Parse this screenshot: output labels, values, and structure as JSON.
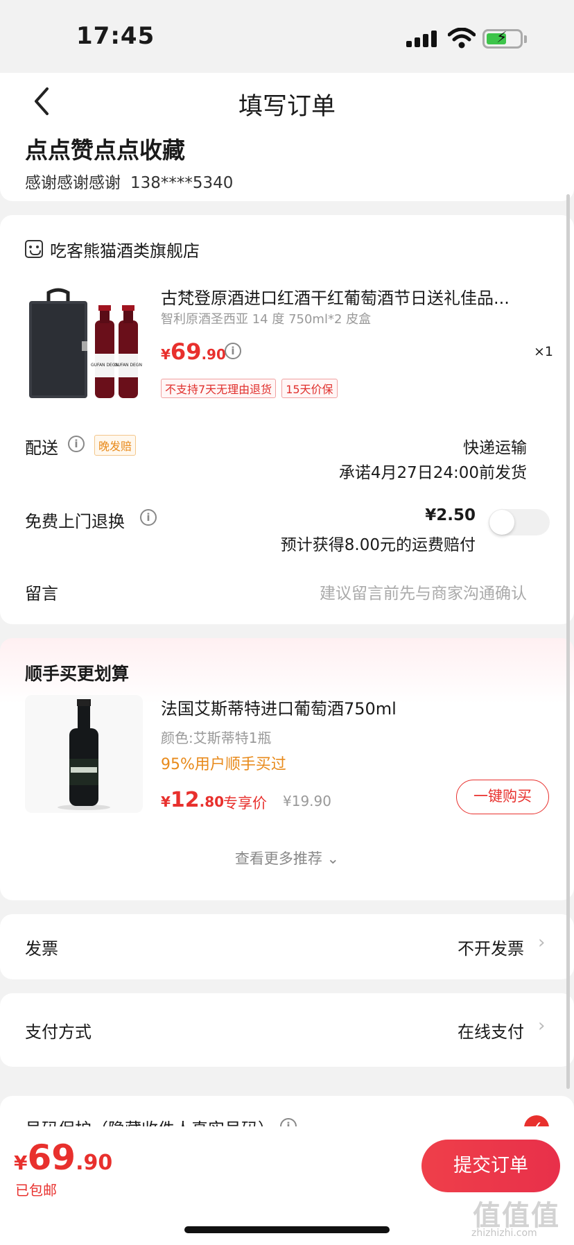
{
  "status_bar": {
    "time": "17:45"
  },
  "nav": {
    "title": "填写订单"
  },
  "address": {
    "name": "点点赞点点收藏",
    "recipient": "感谢感谢感谢",
    "phone": "138****5340"
  },
  "shop": {
    "name": "吃客熊猫酒类旗舰店"
  },
  "product": {
    "title": "古梵登原酒进口红酒干红葡萄酒节日送礼佳品...",
    "spec": "智利原酒圣西亚 14 度 750ml*2 皮盒",
    "price_symbol": "¥",
    "price_int": "69",
    "price_dec": ".90",
    "qty": "×1",
    "tags": [
      "不支持7天无理由退货",
      "15天价保"
    ],
    "wine_label": "GUFAN DEGN"
  },
  "delivery": {
    "label": "配送",
    "tag": "晚发赔",
    "method": "快递运输",
    "promise": "承诺4月27日24:00前发货"
  },
  "return_service": {
    "label": "免费上门退换",
    "price": "¥2.50",
    "note": "预计获得8.00元的运费赔付",
    "enabled": false
  },
  "message": {
    "label": "留言",
    "placeholder": "建议留言前先与商家沟通确认"
  },
  "recommend": {
    "title": "顺手买更划算",
    "name": "法国艾斯蒂特进口葡萄酒750ml",
    "spec": "颜色:艾斯蒂特1瓶",
    "popularity": "95%用户顺手买过",
    "price_symbol": "¥",
    "price_int": "12",
    "price_dec": ".80",
    "exclusive": "专享价",
    "orig_price": "¥19.90",
    "buy_label": "一键购买",
    "more_label": "查看更多推荐 ⌄"
  },
  "invoice": {
    "label": "发票",
    "value": "不开发票"
  },
  "payment": {
    "label": "支付方式",
    "value": "在线支付"
  },
  "protect": {
    "label": "号码保护（隐藏收件人真实号码）",
    "checked": true
  },
  "bottom": {
    "price_symbol": "¥",
    "price_int": "69",
    "price_dec": ".90",
    "shipping": "已包邮",
    "submit_label": "提交订单"
  },
  "watermark": {
    "main": "值值值",
    "sub": "zhizhizhi.com"
  },
  "colors": {
    "accent": "#e8302d",
    "orange": "#e88a1b",
    "bg": "#f2f2f2"
  }
}
